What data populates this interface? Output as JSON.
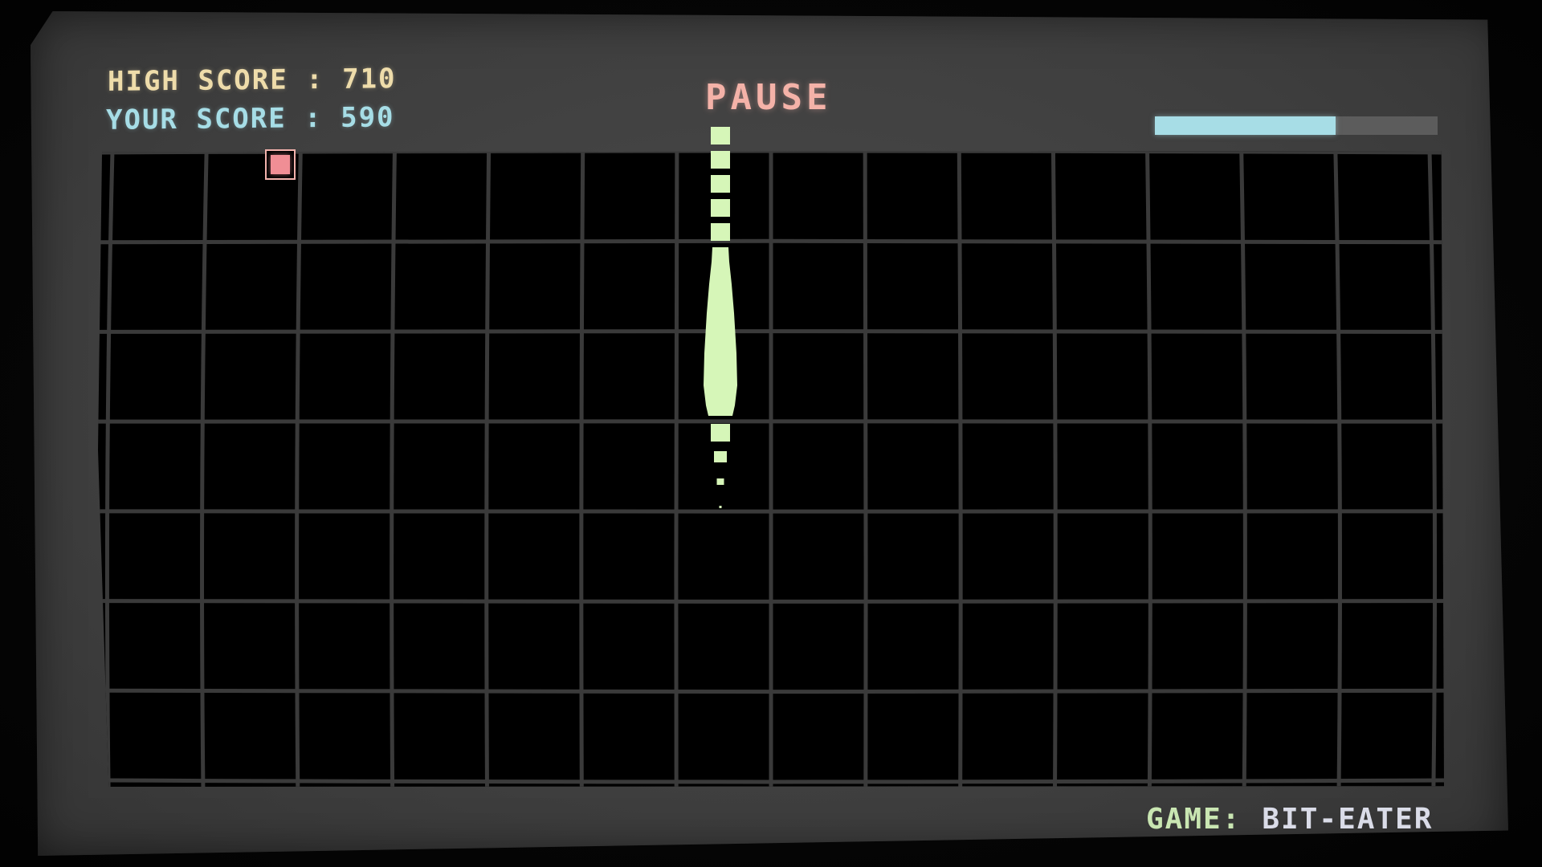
{
  "hud": {
    "high_score_label": "HIGH SCORE : 710",
    "your_score_label": "YOUR SCORE : 590",
    "pause_label": "PAUSE",
    "progress_fraction": 0.64
  },
  "footer": {
    "game_key": "GAME:",
    "game_name": "BIT-EATER"
  },
  "colors": {
    "snake": "#d6f6b8",
    "food": "#f08e95",
    "grid": "#3a3a3a",
    "progress": "#a7dde6"
  }
}
